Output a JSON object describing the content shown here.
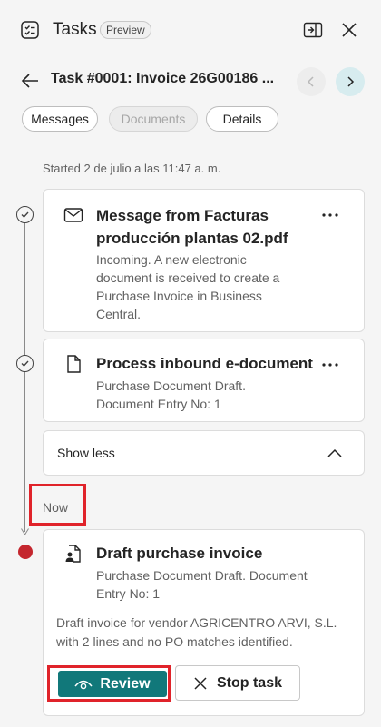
{
  "header": {
    "title": "Tasks",
    "badge": "Preview",
    "icons": [
      "tasks-icon",
      "dock-panel-icon",
      "close-icon"
    ]
  },
  "task": {
    "title": "Task #0001: Invoice 26G00186 ...",
    "back_icon": "back-arrow-icon",
    "prev_icon": "chevron-left-icon",
    "next_icon": "chevron-right-icon"
  },
  "tabs": [
    {
      "label": "Messages",
      "enabled": true
    },
    {
      "label": "Documents",
      "enabled": false
    },
    {
      "label": "Details",
      "enabled": true
    }
  ],
  "started": "Started 2 de julio a las 11:47 a. m.",
  "timeline": [
    {
      "icon": "mail-icon",
      "title_line1": "Message from Facturas",
      "title_line2": "producción plantas 02.pdf",
      "desc_lines": [
        "Incoming. A new electronic",
        "document is received to create a",
        "Purchase Invoice in Business",
        "Central."
      ],
      "status": "completed"
    },
    {
      "icon": "document-icon",
      "title_line1": "Process inbound e-document",
      "desc_lines": [
        "Purchase Document Draft.",
        "Document Entry No: 1"
      ],
      "status": "completed"
    }
  ],
  "show_less": "Show less",
  "now_label": "Now",
  "current_step": {
    "icon": "document-person-icon",
    "title": "Draft purchase invoice",
    "desc_lines": [
      "Purchase Document Draft. Document",
      "Entry No: 1"
    ],
    "body_lines": [
      "Draft invoice for vendor AGRICENTRO ARVI, S.L.",
      "with 2 lines and no PO matches identified."
    ],
    "review_label": "Review",
    "stop_label": "Stop task"
  },
  "colors": {
    "accent": "#11787a",
    "highlight": "#e0232a",
    "current_dot": "#c4262e"
  }
}
